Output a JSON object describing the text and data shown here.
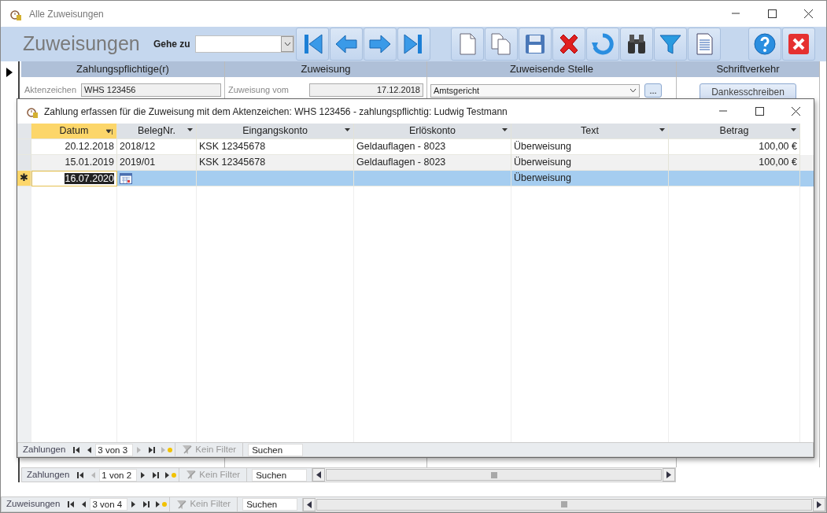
{
  "window": {
    "title": "Alle Zuweisungen"
  },
  "header": {
    "title": "Zuweisungen",
    "goto_label": "Gehe zu",
    "toolbar_groups": [
      [
        {
          "kind": "first"
        },
        {
          "kind": "previous"
        },
        {
          "kind": "next"
        },
        {
          "kind": "last"
        }
      ],
      [
        {
          "kind": "new"
        },
        {
          "kind": "copy"
        },
        {
          "kind": "save"
        },
        {
          "kind": "delete"
        },
        {
          "kind": "refresh"
        },
        {
          "kind": "find"
        },
        {
          "kind": "filter"
        },
        {
          "kind": "report"
        }
      ],
      [
        {
          "kind": "help"
        },
        {
          "kind": "close"
        }
      ]
    ]
  },
  "sections": [
    {
      "title": "Zahlungspflichtige(r)",
      "kind": "field",
      "label": "Aktenzeichen",
      "value": "WHS 123456"
    },
    {
      "title": "Zuweisung",
      "kind": "field",
      "label": "Zuweisung vom",
      "value": "17.12.2018"
    },
    {
      "title": "Zuweisende Stelle",
      "kind": "combo",
      "value": "Amtsgericht",
      "button": "..."
    },
    {
      "title": "Schriftverkehr",
      "kind": "button",
      "button": "Dankesschreiben"
    }
  ],
  "subform_nav": {
    "label": "Zahlungen",
    "record": "1 von 2",
    "filter": "Kein Filter",
    "search": "Suchen",
    "buttons": [
      {
        "kind": "first",
        "disabled": false
      },
      {
        "kind": "previous",
        "disabled": true
      },
      {
        "kind": "next",
        "disabled": false
      },
      {
        "kind": "last",
        "disabled": false
      },
      {
        "kind": "new",
        "disabled": false
      }
    ]
  },
  "main_nav": {
    "label": "Zuweisungen",
    "record": "3 von 4",
    "filter": "Kein Filter",
    "search": "Suchen",
    "buttons": [
      {
        "kind": "first",
        "disabled": false
      },
      {
        "kind": "previous",
        "disabled": false
      },
      {
        "kind": "next",
        "disabled": false
      },
      {
        "kind": "last",
        "disabled": false
      },
      {
        "kind": "new",
        "disabled": false
      }
    ]
  },
  "dialog": {
    "title": "Zahlung erfassen für die Zuweisung mit dem Aktenzeichen: WHS 123456 - zahlungspflichtig: Ludwig Testmann",
    "columns": [
      {
        "label": "Datum",
        "selected": true,
        "sorted": true,
        "numeric": true
      },
      {
        "label": "BelegNr.",
        "selected": false,
        "sorted": false,
        "numeric": false
      },
      {
        "label": "Eingangskonto",
        "selected": false,
        "sorted": false,
        "numeric": false
      },
      {
        "label": "Erlöskonto",
        "selected": false,
        "sorted": false,
        "numeric": false
      },
      {
        "label": "Text",
        "selected": false,
        "sorted": false,
        "numeric": false
      },
      {
        "label": "Betrag",
        "selected": false,
        "sorted": false,
        "numeric": true
      }
    ],
    "rows": [
      {
        "selected": false,
        "cells": [
          "20.12.2018",
          "2018/12",
          "KSK 12345678",
          "Geldauflagen - 8023",
          "Überweisung",
          "100,00 €"
        ]
      },
      {
        "selected": false,
        "cells": [
          "15.01.2019",
          "2019/01",
          "KSK 12345678",
          "Geldauflagen - 8023",
          "Überweisung",
          "100,00 €"
        ]
      },
      {
        "selected": true,
        "marker": "✱",
        "cells": [
          "16.07.2020",
          null,
          null,
          null,
          "Überweisung",
          null
        ]
      }
    ],
    "nav": {
      "label": "Zahlungen",
      "record": "3 von 3",
      "filter": "Kein Filter",
      "search": "Suchen",
      "buttons": [
        {
          "kind": "first",
          "disabled": false
        },
        {
          "kind": "previous",
          "disabled": false
        },
        {
          "kind": "next",
          "disabled": true
        },
        {
          "kind": "last",
          "disabled": false
        },
        {
          "kind": "new",
          "disabled": true
        }
      ]
    }
  }
}
